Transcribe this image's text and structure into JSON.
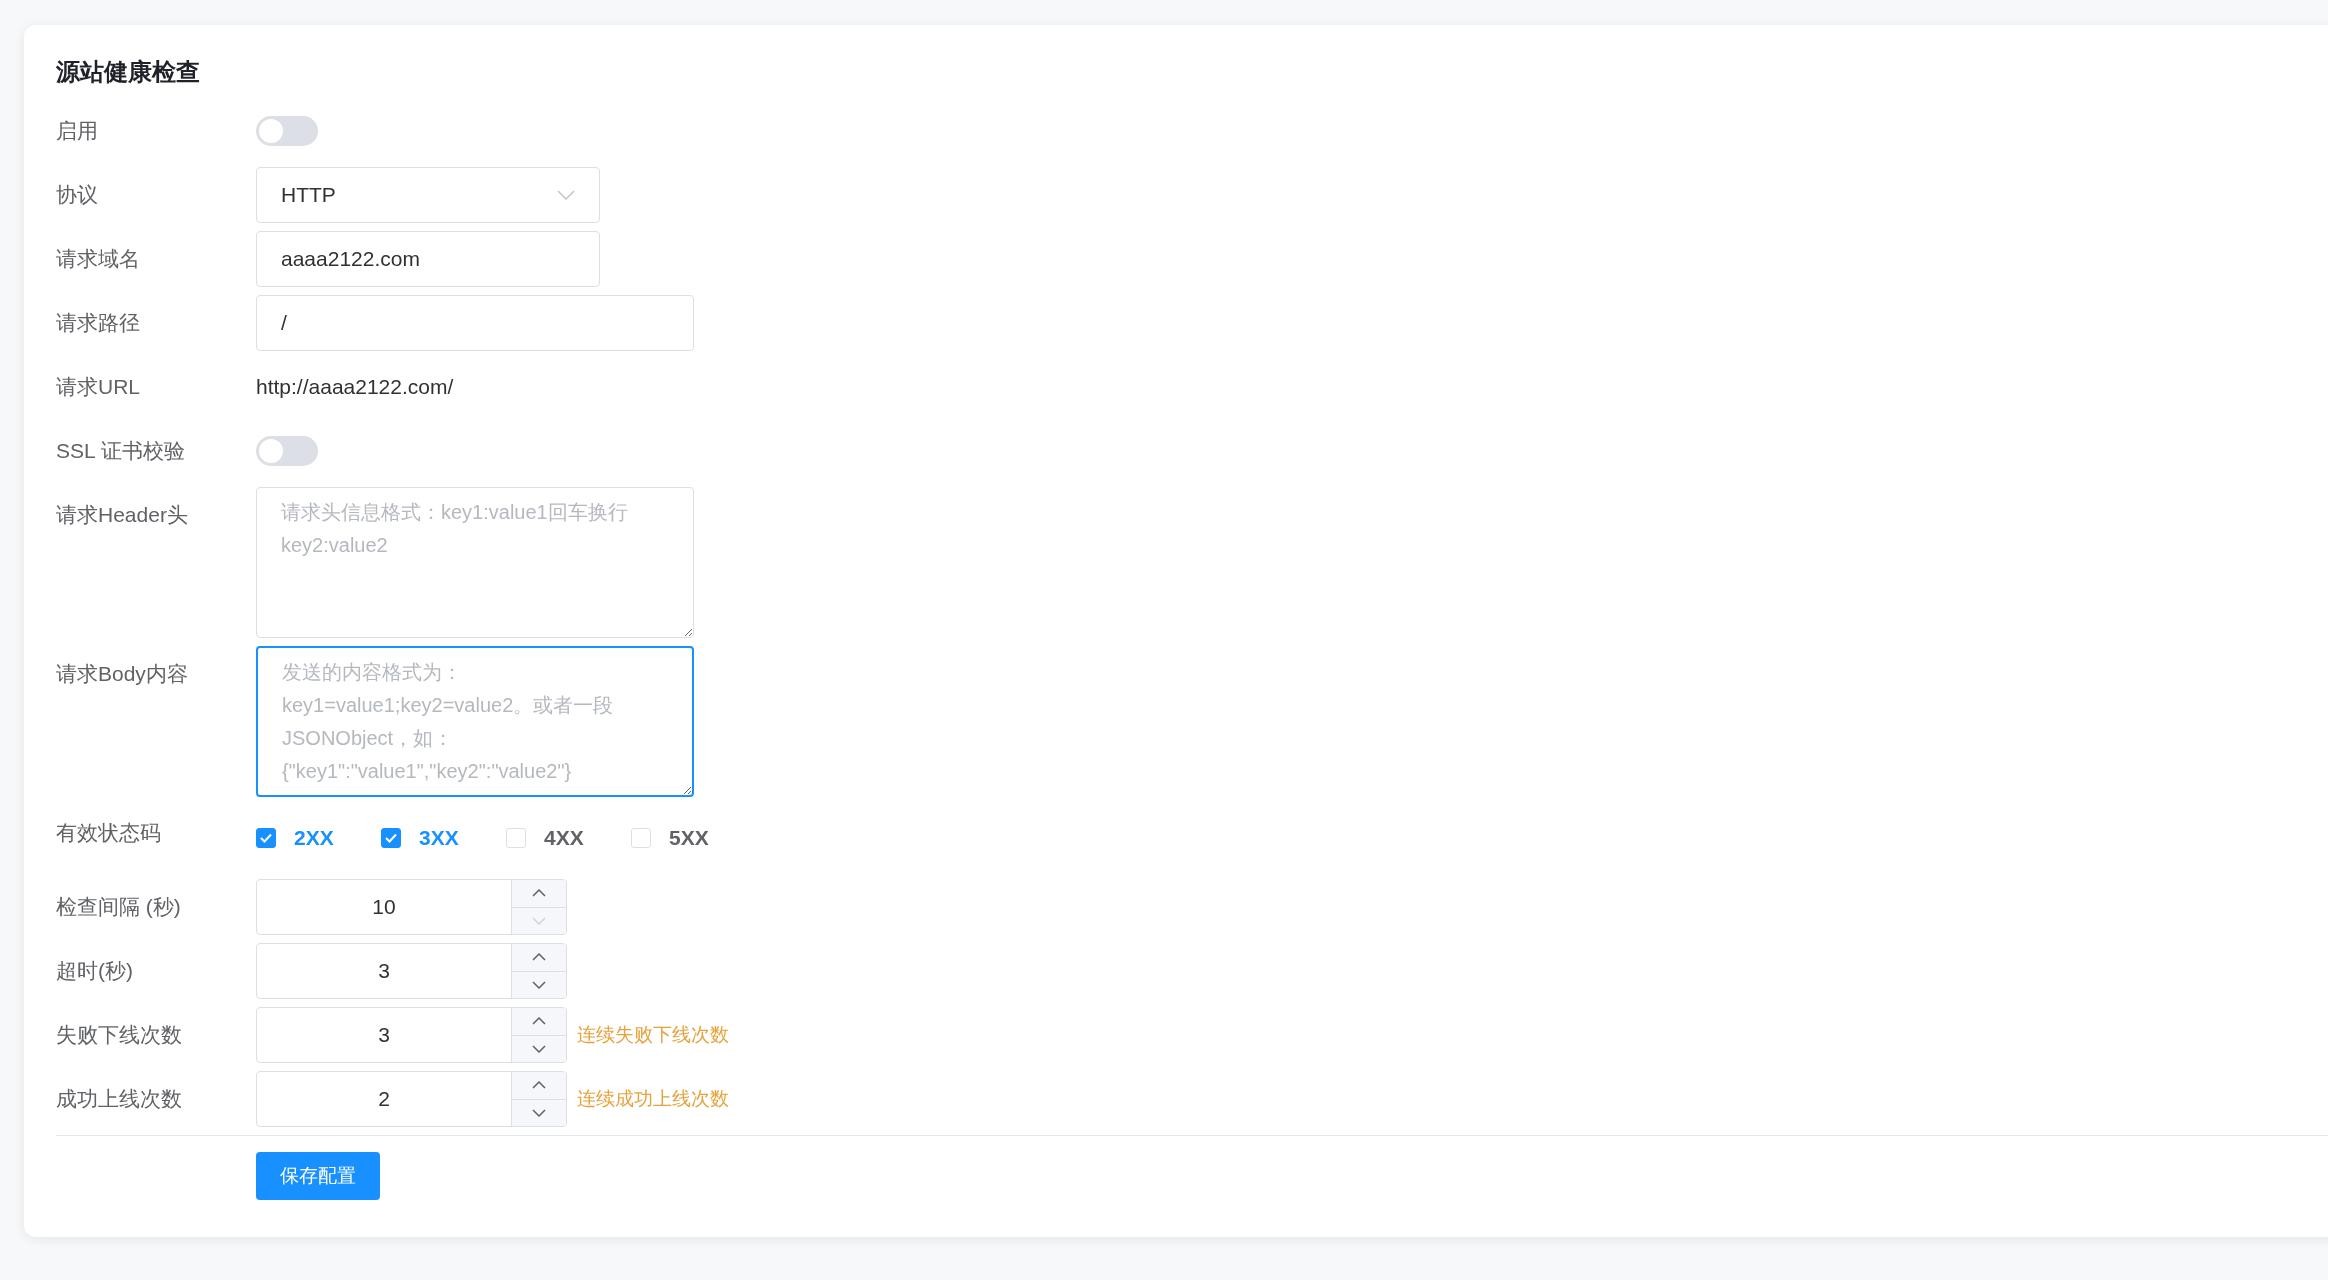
{
  "title": "源站健康检查",
  "fields": [
    {
      "kind": "switch",
      "label": "启用",
      "on": false
    },
    {
      "kind": "select",
      "label": "协议",
      "value": "HTTP"
    },
    {
      "kind": "text",
      "label": "请求域名",
      "value": "aaaa2122.com"
    },
    {
      "kind": "text",
      "label": "请求路径",
      "value": "/"
    },
    {
      "kind": "static",
      "label": "请求URL",
      "value": "http://aaaa2122.com/"
    },
    {
      "kind": "switch",
      "label": "SSL 证书校验",
      "on": false
    },
    {
      "kind": "textarea",
      "label": "请求Header头",
      "placeholder": "请求头信息格式：key1:value1回车换行\nkey2:value2",
      "focused": false
    },
    {
      "kind": "textarea",
      "label": "请求Body内容",
      "placeholder": "发送的内容格式为：\nkey1=value1;key2=value2。或者一段\nJSONObject，如：\n{\"key1\":\"value1\",\"key2\":\"value2\"}",
      "focused": true
    },
    {
      "kind": "checkboxes",
      "label": "有效状态码",
      "options": [
        {
          "label": "2XX",
          "checked": true
        },
        {
          "label": "3XX",
          "checked": true
        },
        {
          "label": "4XX",
          "checked": false
        },
        {
          "label": "5XX",
          "checked": false
        }
      ]
    },
    {
      "kind": "number",
      "label": "检查间隔 (秒)",
      "value": "10",
      "decrease_disabled": true
    },
    {
      "kind": "number",
      "label": "超时(秒)",
      "value": "3",
      "decrease_disabled": false
    },
    {
      "kind": "number",
      "label": "失败下线次数",
      "value": "3",
      "decrease_disabled": false,
      "hint": "连续失败下线次数"
    },
    {
      "kind": "number",
      "label": "成功上线次数",
      "value": "2",
      "decrease_disabled": false,
      "hint": "连续成功上线次数"
    }
  ],
  "save_button": "保存配置"
}
